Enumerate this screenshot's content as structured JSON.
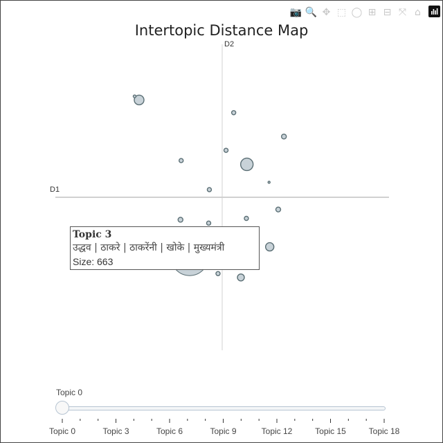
{
  "modebar": {
    "buttons": [
      {
        "name": "camera-icon",
        "glyph": "📷",
        "active": false
      },
      {
        "name": "zoom-icon",
        "glyph": "🔍",
        "active": true
      },
      {
        "name": "pan-icon",
        "glyph": "✥",
        "active": false
      },
      {
        "name": "box-select-icon",
        "glyph": "⬚",
        "active": false
      },
      {
        "name": "lasso-select-icon",
        "glyph": "◯",
        "active": false
      },
      {
        "name": "zoom-in-icon",
        "glyph": "⊞",
        "active": false
      },
      {
        "name": "zoom-out-icon",
        "glyph": "⊟",
        "active": false
      },
      {
        "name": "autoscale-icon",
        "glyph": "⤧",
        "active": false
      },
      {
        "name": "home-icon",
        "glyph": "⌂",
        "active": false
      }
    ]
  },
  "chart_data": {
    "type": "scatter",
    "title": "Intertopic Distance Map",
    "xlabel": "D1",
    "ylabel": "D2",
    "xlim": [
      -10,
      10
    ],
    "ylim": [
      -10,
      10
    ],
    "marker_fill": "#c8d2d8",
    "marker_stroke": "#5a6e74",
    "axis_line_color": "#d0d0d0",
    "points": [
      {
        "x": -4.98,
        "y": 6.36,
        "r": 7
      },
      {
        "x": -5.25,
        "y": 6.6,
        "r": 2
      },
      {
        "x": 0.69,
        "y": 5.53,
        "r": 3
      },
      {
        "x": 3.7,
        "y": 3.97,
        "r": 3.5
      },
      {
        "x": 0.23,
        "y": 3.07,
        "r": 3
      },
      {
        "x": 1.48,
        "y": 2.15,
        "r": 9
      },
      {
        "x": -2.46,
        "y": 2.4,
        "r": 3
      },
      {
        "x": 2.81,
        "y": 0.98,
        "r": 1.5
      },
      {
        "x": -0.77,
        "y": 0.5,
        "r": 3
      },
      {
        "x": 3.36,
        "y": -0.8,
        "r": 3.5
      },
      {
        "x": -2.5,
        "y": -1.47,
        "r": 3.5
      },
      {
        "x": 1.45,
        "y": -1.38,
        "r": 3
      },
      {
        "x": -0.81,
        "y": -1.69,
        "r": 3
      },
      {
        "x": 2.85,
        "y": -3.24,
        "r": 6
      },
      {
        "x": -1.95,
        "y": -3.9,
        "r": 27
      },
      {
        "x": -0.25,
        "y": -4.99,
        "r": 3
      },
      {
        "x": 1.12,
        "y": -5.24,
        "r": 5
      }
    ]
  },
  "tooltip": {
    "title": "Topic 3",
    "words": "उद्धव | ठाकरे | ठाकरेंनी | खोके | मुख्यमंत्री",
    "size": "Size: 663"
  },
  "slider": {
    "current_label": "Topic 0",
    "value": 0,
    "min": 0,
    "max": 18,
    "step_labels": [
      {
        "label": "Topic 0",
        "value": 0
      },
      {
        "label": "Topic 3",
        "value": 3
      },
      {
        "label": "Topic 6",
        "value": 6
      },
      {
        "label": "Topic 9",
        "value": 9
      },
      {
        "label": "Topic 12",
        "value": 12
      },
      {
        "label": "Topic 15",
        "value": 15
      },
      {
        "label": "Topic 18",
        "value": 18
      }
    ]
  }
}
